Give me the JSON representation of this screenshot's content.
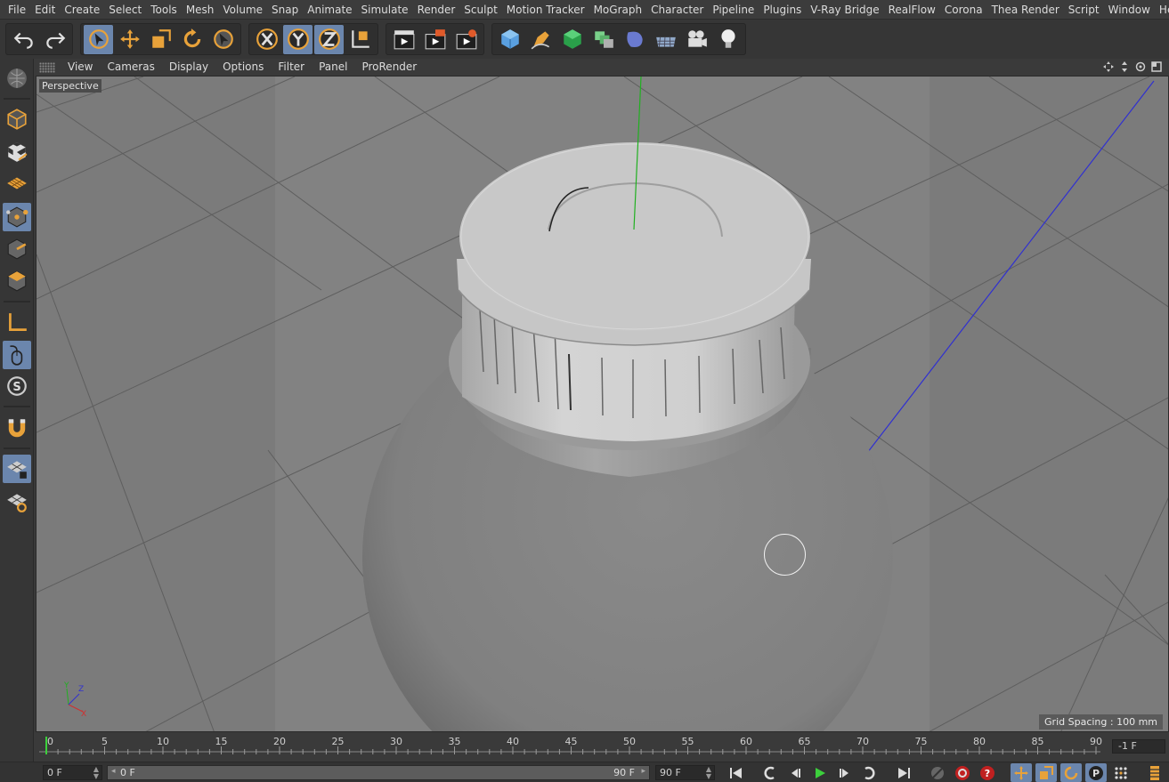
{
  "menu": [
    "File",
    "Edit",
    "Create",
    "Select",
    "Tools",
    "Mesh",
    "Volume",
    "Snap",
    "Animate",
    "Simulate",
    "Render",
    "Sculpt",
    "Motion Tracker",
    "MoGraph",
    "Character",
    "Pipeline",
    "Plugins",
    "V-Ray Bridge",
    "RealFlow",
    "Corona",
    "Thea Render",
    "Script",
    "Window",
    "Help"
  ],
  "viewport_menu": [
    "View",
    "Cameras",
    "Display",
    "Options",
    "Filter",
    "Panel",
    "ProRender"
  ],
  "viewport": {
    "camera_label": "Perspective",
    "grid_spacing": "Grid Spacing : 100 mm"
  },
  "timeline": {
    "ticks": [
      "0",
      "5",
      "10",
      "15",
      "20",
      "25",
      "30",
      "35",
      "40",
      "45",
      "50",
      "55",
      "60",
      "65",
      "70",
      "75",
      "80",
      "85",
      "90"
    ],
    "current_frame_field": "-1 F"
  },
  "transport": {
    "start_frame": "0 F",
    "range_start": "0 F",
    "range_end": "90 F",
    "end_frame": "90 F"
  },
  "toolbar_icons": [
    "undo-icon",
    "redo-icon",
    "live-selection-icon",
    "move-icon",
    "scale-icon",
    "rotate-icon",
    "recent-tool-icon",
    "x-axis-icon",
    "y-axis-icon",
    "z-axis-icon",
    "world-coordinate-icon",
    "render-view-icon",
    "render-picture-viewer-icon",
    "edit-render-settings-icon",
    "cube-icon",
    "pen-icon",
    "subdivision-icon",
    "cloner-icon",
    "deformer-icon",
    "floor-icon",
    "camera-icon",
    "light-icon"
  ],
  "colors": {
    "selected": "#6b86ad",
    "viewport_bg": "#7b7b7b",
    "accent_orange": "#e8a23a",
    "y_axis": "#20b020",
    "z_axis": "#3030d0"
  }
}
